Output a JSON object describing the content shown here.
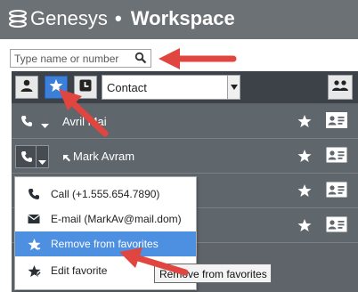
{
  "header": {
    "brand": "Genesys",
    "separator": "•",
    "product": "Workspace"
  },
  "search": {
    "placeholder": "Type name or number",
    "icon": "magnifier-icon"
  },
  "toolbar": {
    "filter_value": "Contact",
    "buttons": [
      "person-icon",
      "star-icon",
      "history-icon",
      "group-icon"
    ]
  },
  "contacts": [
    {
      "name": "Avril Mai"
    },
    {
      "name": "Mark Avram"
    },
    {
      "name": ""
    },
    {
      "name": ""
    }
  ],
  "menu": {
    "items": [
      {
        "label": "Call (+1.555.654.7890)",
        "icon": "phone-icon"
      },
      {
        "label": "E-mail (MarkAv@mail.dom)",
        "icon": "envelope-icon"
      },
      {
        "label": "Remove from favorites",
        "icon": "star-remove-icon"
      },
      {
        "label": "Edit favorite",
        "icon": "star-edit-icon"
      }
    ],
    "highlighted_index": 2
  },
  "tooltip": {
    "text": "Remove from favorites"
  },
  "colors": {
    "header_bg": "#6c7176",
    "toolbar_bg": "#3c4248",
    "row_bg": "#5f666c",
    "active_blue": "#3b7fd8",
    "highlight_blue": "#4d8fe0",
    "annotation_red": "#e0463f"
  }
}
